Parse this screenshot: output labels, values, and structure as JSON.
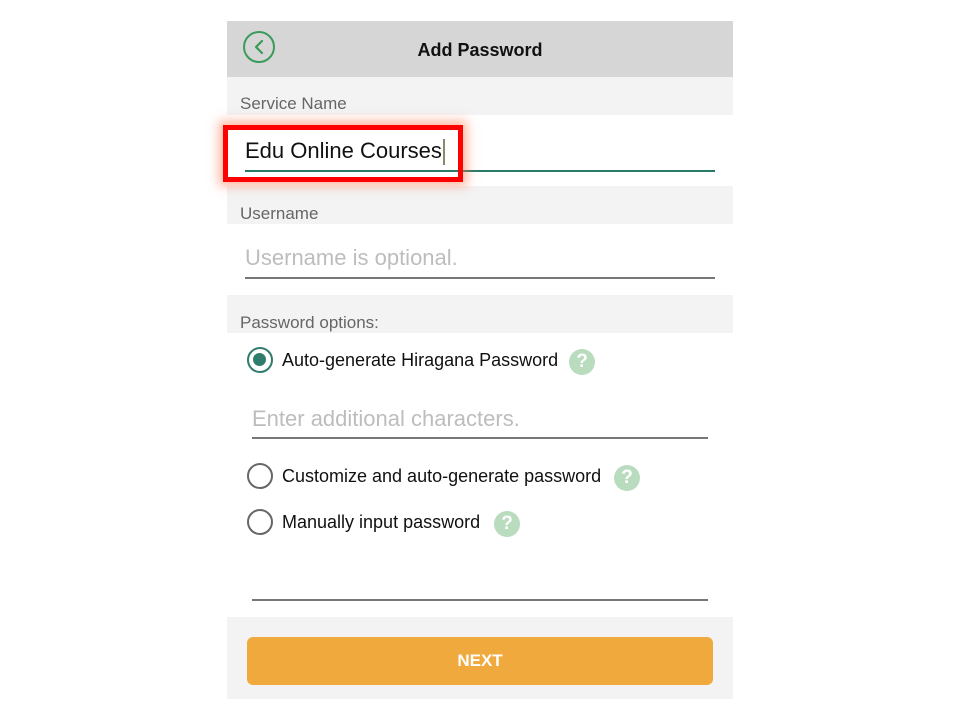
{
  "header": {
    "title": "Add Password",
    "back_icon": "chevron-left-icon",
    "accent": "#3a9a5a"
  },
  "service": {
    "label": "Service Name",
    "value": "Edu Online Courses"
  },
  "username": {
    "label": "Username",
    "placeholder": "Username is optional."
  },
  "password_options": {
    "label": "Password options:",
    "options": [
      {
        "label": "Auto-generate Hiragana Password",
        "selected": true
      },
      {
        "label": "Customize and auto-generate password",
        "selected": false
      },
      {
        "label": "Manually input password",
        "selected": false
      }
    ],
    "additional_placeholder": "Enter additional characters.",
    "help_symbol": "?"
  },
  "footer": {
    "next_label": "NEXT",
    "button_color": "#f0a93c"
  }
}
